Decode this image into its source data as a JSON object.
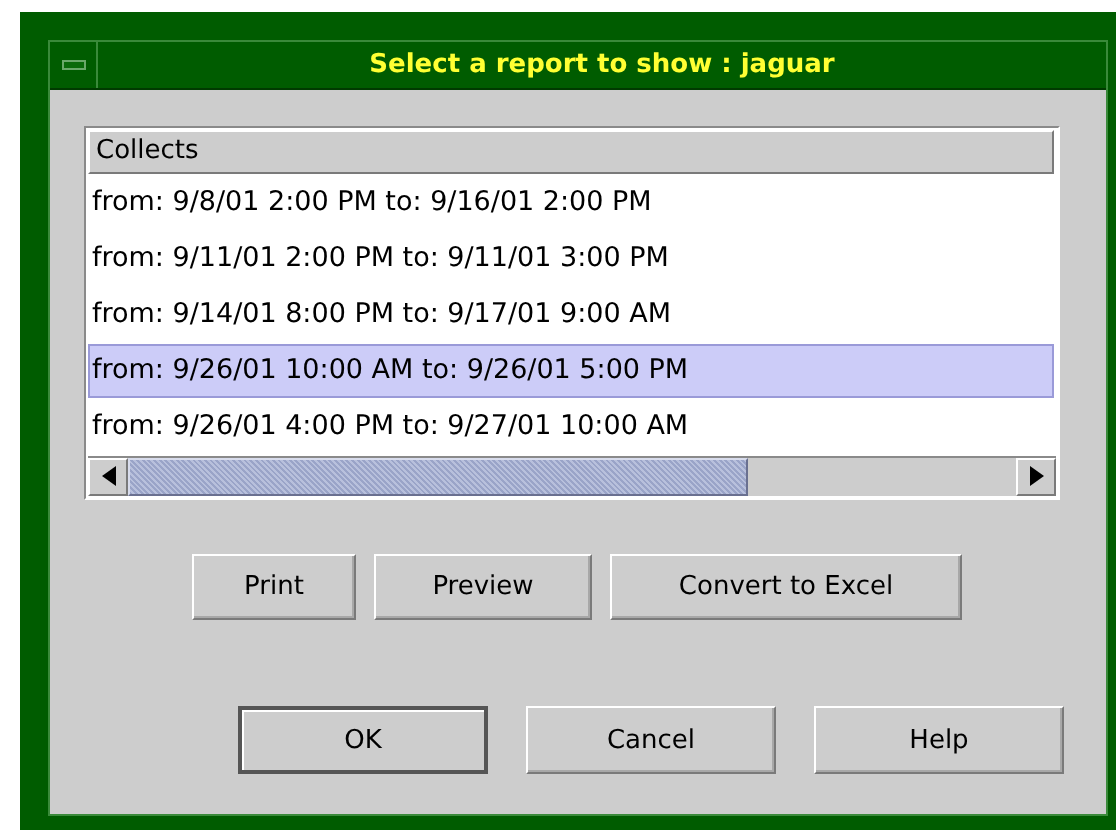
{
  "window": {
    "title": "Select a report to show : jaguar"
  },
  "list": {
    "header": "Collects",
    "rows": [
      {
        "text": "from: 9/8/01 2:00 PM to: 9/16/01 2:00 PM",
        "selected": false
      },
      {
        "text": "from: 9/11/01 2:00 PM to: 9/11/01 3:00 PM",
        "selected": false
      },
      {
        "text": "from: 9/14/01 8:00 PM to: 9/17/01 9:00 AM",
        "selected": false
      },
      {
        "text": "from: 9/26/01 10:00 AM to: 9/26/01 5:00 PM",
        "selected": true
      },
      {
        "text": "from: 9/26/01 4:00 PM to: 9/27/01 10:00 AM",
        "selected": false
      }
    ]
  },
  "actions": [
    {
      "label": "Print"
    },
    {
      "label": "Preview"
    },
    {
      "label": "Convert to Excel"
    }
  ],
  "buttons": [
    {
      "label": "OK",
      "default": true
    },
    {
      "label": "Cancel",
      "default": false
    },
    {
      "label": "Help",
      "default": false
    }
  ]
}
